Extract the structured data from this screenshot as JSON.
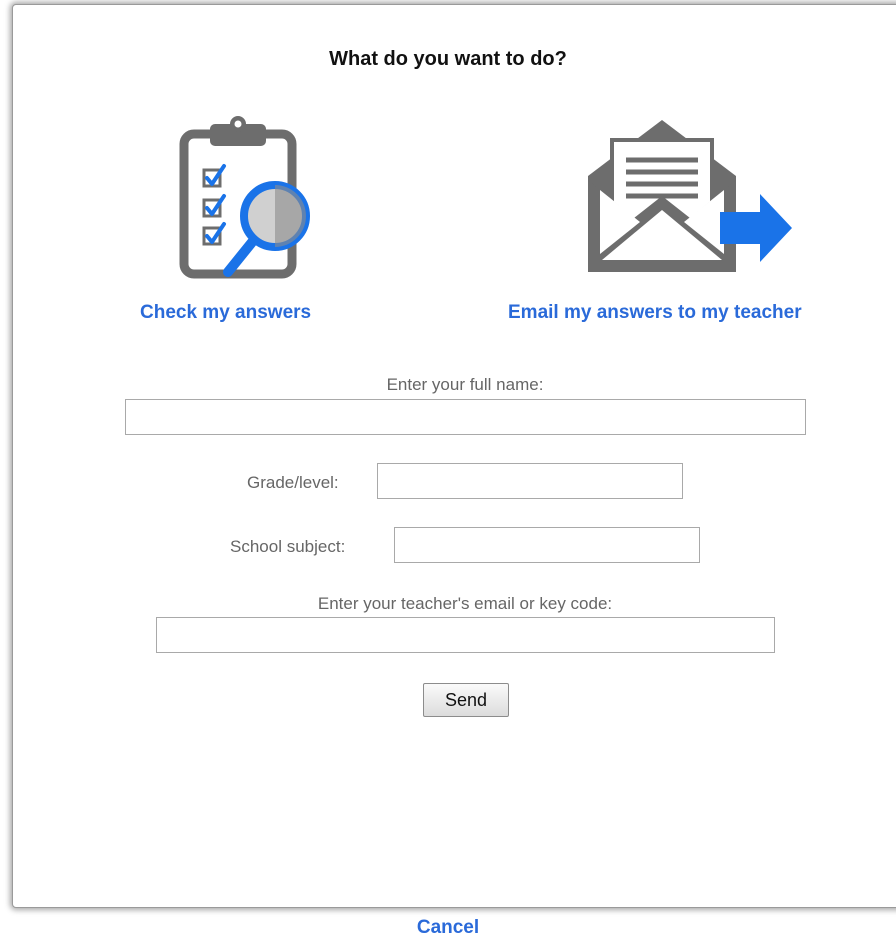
{
  "dialog": {
    "title": "What do you want to do?",
    "options": [
      {
        "label": "Check my answers",
        "icon": "clipboard-magnifier-icon"
      },
      {
        "label": "Email my answers to my teacher",
        "icon": "envelope-send-icon"
      }
    ],
    "fields": {
      "full_name_label": "Enter your full name:",
      "full_name_value": "",
      "grade_label": "Grade/level:",
      "grade_value": "",
      "subject_label": "School subject:",
      "subject_value": "",
      "teacher_label": "Enter your teacher's email or key code:",
      "teacher_value": ""
    },
    "send_label": "Send",
    "cancel_label": "Cancel"
  },
  "colors": {
    "link": "#2a6ad9",
    "icon_gray": "#6d6d6d",
    "icon_blue": "#1a73e8"
  }
}
